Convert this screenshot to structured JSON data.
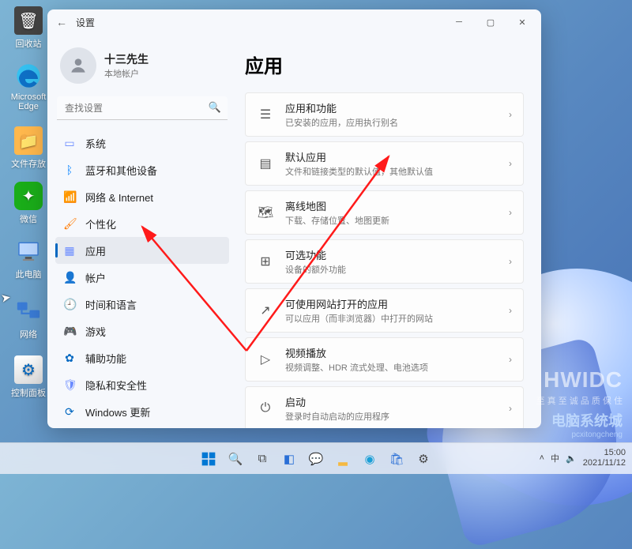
{
  "desktop_icons": [
    {
      "label": "回收站",
      "glyph": "🗑"
    },
    {
      "label": "Microsoft Edge",
      "glyph": "edge"
    },
    {
      "label": "文件存放",
      "glyph": "📁"
    },
    {
      "label": "微信",
      "glyph": "✦"
    },
    {
      "label": "此电脑",
      "glyph": "pc"
    },
    {
      "label": "网络",
      "glyph": "net"
    },
    {
      "label": "控制面板",
      "glyph": "⚙"
    }
  ],
  "window": {
    "title": "设置",
    "user": {
      "name": "十三先生",
      "sub": "本地帐户"
    },
    "search": {
      "placeholder": "查找设置"
    },
    "nav": [
      {
        "icon": "▭",
        "label": "系统",
        "cls": "c-sys"
      },
      {
        "icon": "ᛒ",
        "label": "蓝牙和其他设备",
        "cls": "c-bt"
      },
      {
        "icon": "📶",
        "label": "网络 & Internet",
        "cls": "c-net"
      },
      {
        "icon": "🖌",
        "label": "个性化",
        "cls": "c-pers"
      },
      {
        "icon": "▦",
        "label": "应用",
        "cls": "c-app",
        "active": true
      },
      {
        "icon": "👤",
        "label": "帐户",
        "cls": "c-acc"
      },
      {
        "icon": "🕘",
        "label": "时间和语言",
        "cls": "c-time"
      },
      {
        "icon": "🎮",
        "label": "游戏",
        "cls": "c-game"
      },
      {
        "icon": "✿",
        "label": "辅助功能",
        "cls": "c-acces"
      },
      {
        "icon": "🛡",
        "label": "隐私和安全性",
        "cls": "c-priv"
      },
      {
        "icon": "⟳",
        "label": "Windows 更新",
        "cls": "c-upd"
      }
    ],
    "page_title": "应用",
    "cards": [
      {
        "icon": "☰",
        "title": "应用和功能",
        "sub": "已安装的应用，应用执行别名"
      },
      {
        "icon": "▤",
        "title": "默认应用",
        "sub": "文件和链接类型的默认值，其他默认值"
      },
      {
        "icon": "🗺",
        "title": "离线地图",
        "sub": "下载、存储位置、地图更新"
      },
      {
        "icon": "⊞",
        "title": "可选功能",
        "sub": "设备的额外功能"
      },
      {
        "icon": "↗",
        "title": "可使用网站打开的应用",
        "sub": "可以应用（而非浏览器）中打开的网站"
      },
      {
        "icon": "▷",
        "title": "视频播放",
        "sub": "视频调整、HDR 流式处理、电池选项"
      },
      {
        "icon": "⏻",
        "title": "启动",
        "sub": "登录时自动启动的应用程序"
      }
    ]
  },
  "tray": {
    "time": "15:00",
    "date": "2021/11/12"
  },
  "watermark": {
    "a": "HWIDC",
    "b": "至 真 至 诚    品 质 保 住",
    "c": "电脑系统城",
    "d": "pcxitongcheng"
  }
}
